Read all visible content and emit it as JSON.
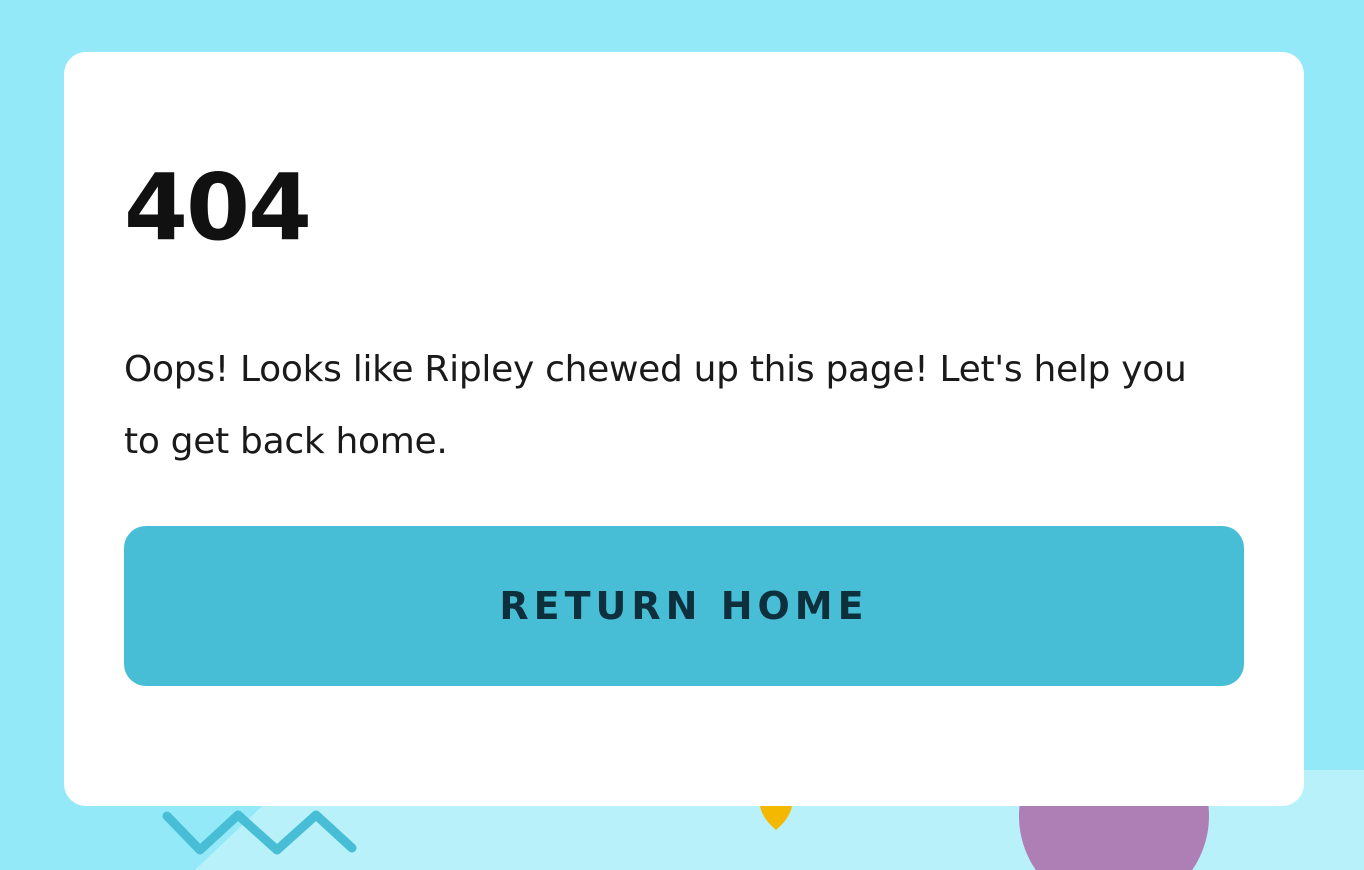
{
  "error": {
    "code": "404",
    "message": "Oops! Looks like Ripley chewed up this page! Let's help you to get back home."
  },
  "actions": {
    "return_home_label": "RETURN HOME"
  },
  "colors": {
    "background": "#93e9f8",
    "card": "#ffffff",
    "button": "#47bdd6",
    "button_text": "#0e2f3c",
    "zigzag": "#47bdd6",
    "circle": "#ae7fb5",
    "drop": "#f5b800"
  },
  "decorations": [
    "zigzag-shape",
    "drop-shape",
    "circle-shape"
  ]
}
